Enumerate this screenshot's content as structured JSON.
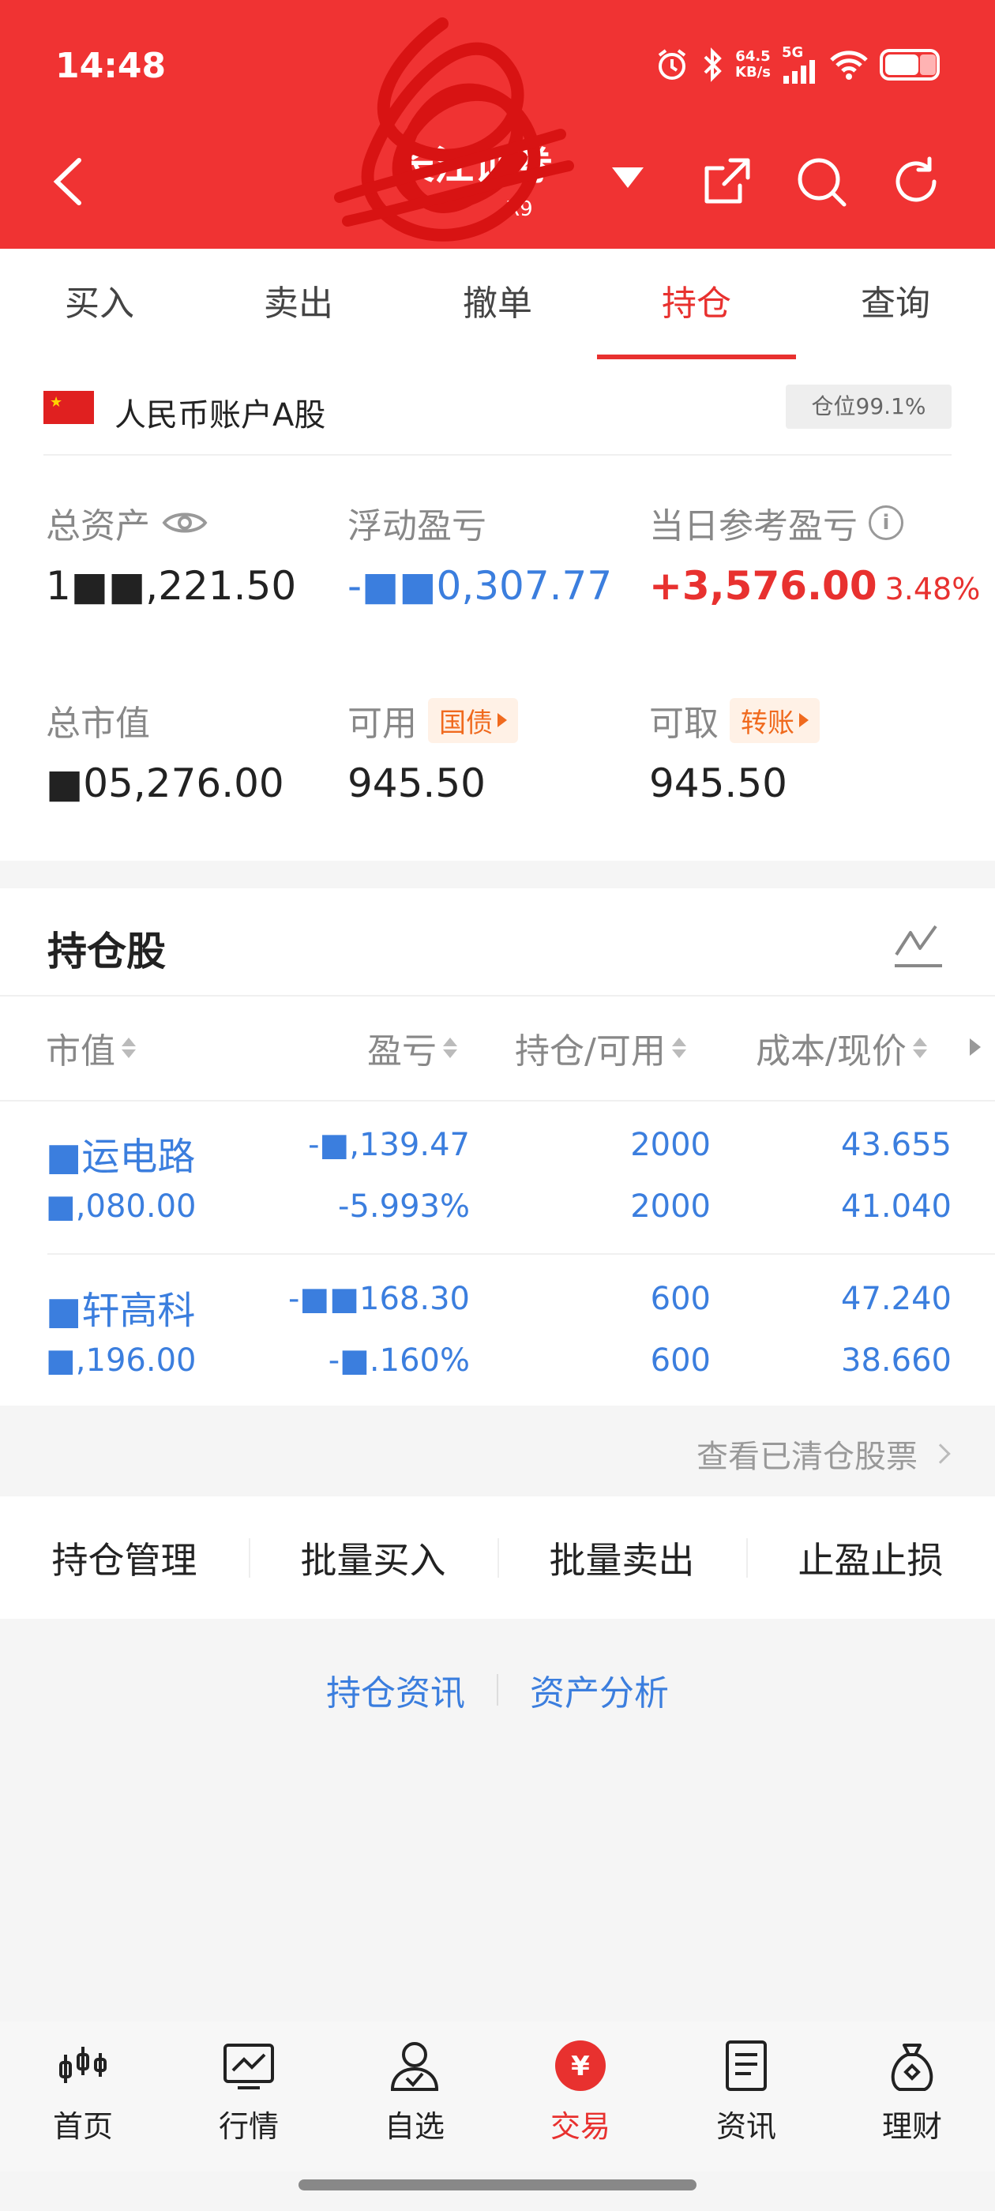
{
  "status_bar": {
    "time": "14:48",
    "net_speed_value": "64.5",
    "net_speed_unit": "KB/s",
    "network": "5G"
  },
  "header": {
    "broker_title": "长江证券",
    "broker_sub": "R9"
  },
  "tabs": [
    {
      "label": "买入"
    },
    {
      "label": "卖出"
    },
    {
      "label": "撤单"
    },
    {
      "label": "持仓",
      "active": true
    },
    {
      "label": "查询"
    }
  ],
  "account": {
    "name": "人民币账户A股",
    "position_badge": "仓位99.1%",
    "metrics": {
      "total_assets": {
        "label": "总资产",
        "value": "1■■,221.50"
      },
      "floating_pl": {
        "label": "浮动盈亏",
        "value": "-■■0,307.77"
      },
      "daily_pl": {
        "label": "当日参考盈亏",
        "value": "+3,576.00",
        "pct": "3.48%"
      },
      "market_value": {
        "label": "总市值",
        "value": "■05,276.00"
      },
      "available": {
        "label": "可用",
        "value": "945.50",
        "tag": "国债"
      },
      "withdrawable": {
        "label": "可取",
        "value": "945.50",
        "tag": "转账"
      }
    }
  },
  "holdings": {
    "title": "持仓股",
    "columns": {
      "market_value": "市值",
      "pl": "盈亏",
      "qty": "持仓/可用",
      "cost": "成本/现价"
    },
    "rows": [
      {
        "name": "■运电路",
        "market_value": "■,080.00",
        "pl": "-■,139.47",
        "pl_pct": "-5.993%",
        "qty": "2000",
        "avail": "2000",
        "cost": "43.655",
        "price": "41.040"
      },
      {
        "name": "■轩高科",
        "market_value": "■,196.00",
        "pl": "-■■168.30",
        "pl_pct": "-■.160%",
        "qty": "600",
        "avail": "600",
        "cost": "47.240",
        "price": "38.660"
      }
    ]
  },
  "cleared_link": "查看已清仓股票",
  "actions": [
    "持仓管理",
    "批量买入",
    "批量卖出",
    "止盈止损"
  ],
  "links": [
    "持仓资讯",
    "资产分析"
  ],
  "bottom_nav": [
    {
      "label": "首页",
      "icon": "home-candles-icon"
    },
    {
      "label": "行情",
      "icon": "market-chart-icon"
    },
    {
      "label": "自选",
      "icon": "watchlist-user-icon"
    },
    {
      "label": "交易",
      "icon": "trade-yuan-icon",
      "active": true
    },
    {
      "label": "资讯",
      "icon": "news-doc-icon"
    },
    {
      "label": "理财",
      "icon": "wealth-bag-icon"
    }
  ],
  "colors": {
    "brand_red": "#f03333",
    "accent_red": "#e8312f",
    "link_blue": "#3b7ede",
    "tag_orange": "#f06a1e"
  }
}
